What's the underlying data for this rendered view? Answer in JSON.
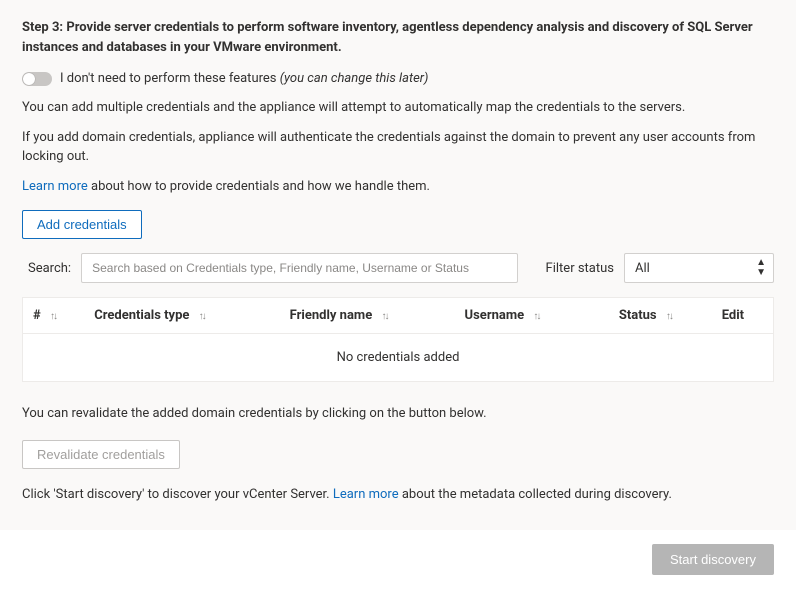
{
  "step": {
    "title": "Step 3: Provide server credentials to perform software inventory, agentless dependency analysis and discovery of SQL Server instances and databases in your VMware environment."
  },
  "toggle": {
    "label_plain": "I don't need to perform these features",
    "label_italic": "(you can change this later)",
    "state": "off"
  },
  "paragraphs": {
    "p1": "You can add multiple credentials and the appliance will attempt to automatically map the credentials to the servers.",
    "p2": "If you add domain credentials, appliance will authenticate the credentials against  the domain to prevent any user accounts from locking out."
  },
  "learn_more": {
    "link": "Learn more",
    "tail": " about how to provide credentials and how we handle them."
  },
  "add_button": "Add credentials",
  "search": {
    "label": "Search:",
    "placeholder": "Search based on Credentials type, Friendly name, Username or Status"
  },
  "filter": {
    "label": "Filter status",
    "selected": "All",
    "options": [
      "All"
    ]
  },
  "table": {
    "columns": {
      "idx": "#",
      "type": "Credentials type",
      "friendly": "Friendly name",
      "username": "Username",
      "status": "Status",
      "edit": "Edit"
    },
    "empty": "No credentials added",
    "rows": []
  },
  "revalidate": {
    "text": "You can revalidate the added domain credentials by clicking on the button below.",
    "button": "Revalidate credentials"
  },
  "discovery": {
    "pre": "Click 'Start discovery' to discover your vCenter Server. ",
    "link": "Learn more",
    "post": " about the metadata collected during discovery."
  },
  "footer": {
    "start": "Start discovery"
  }
}
